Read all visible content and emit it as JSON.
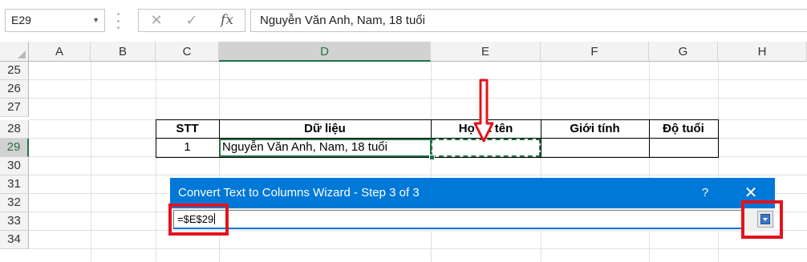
{
  "formula_bar": {
    "name_box": "E29",
    "cancel_glyph": "✕",
    "enter_glyph": "✓",
    "fx_label": "fx",
    "formula": "Nguyễn Văn Anh, Nam, 18 tuổi"
  },
  "columns": [
    "A",
    "B",
    "C",
    "D",
    "E",
    "F",
    "G",
    "H"
  ],
  "rows": [
    "25",
    "26",
    "27",
    "28",
    "29",
    "30",
    "31",
    "32",
    "33",
    "34"
  ],
  "selected": {
    "column": "D",
    "row": "29"
  },
  "table": {
    "headers": [
      "STT",
      "Dữ liệu",
      "Họ và tên",
      "Giới tính",
      "Độ tuổi"
    ],
    "row": [
      "1",
      "Nguyễn Văn Anh, Nam, 18 tuổi",
      "",
      "",
      ""
    ]
  },
  "dialog": {
    "title": "Convert Text to Columns Wizard - Step 3 of 3",
    "help": "?",
    "close": "✕",
    "reference": "=$E$29",
    "title_color": "#0078d7"
  },
  "annotation_color": "#e3131b"
}
